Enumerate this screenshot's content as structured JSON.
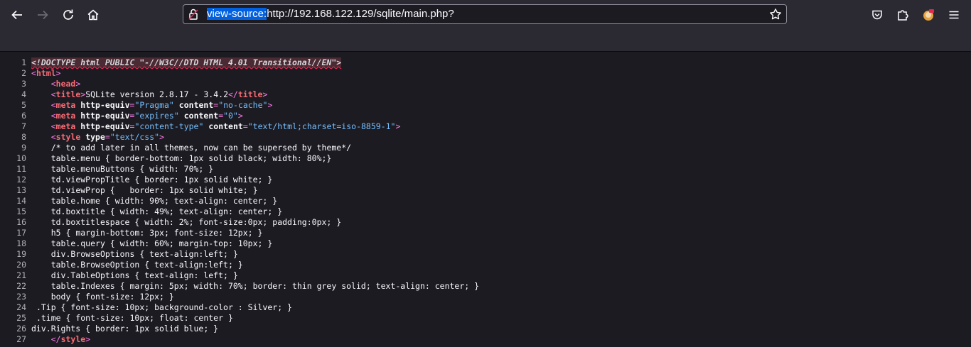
{
  "browser": {
    "url_prefix": "view-source:",
    "url_rest": "http://192.168.122.129/sqlite/main.php?"
  },
  "source": {
    "doctype": "<!DOCTYPE html PUBLIC \"-//W3C//DTD HTML 4.01 Transitional//EN\">",
    "html_open": "html",
    "head_open": "head",
    "title_tag": "title",
    "title_text": "SQLite version 2.8.17 - 3.4.2",
    "meta_tag": "meta",
    "http_equiv": "http-equiv",
    "content": "content",
    "meta1_equiv": "\"Pragma\"",
    "meta1_content": "\"no-cache\"",
    "meta2_equiv": "\"expires\"",
    "meta2_content": "\"0\"",
    "meta3_equiv": "\"content-type\"",
    "meta3_content": "\"text/html;charset=iso-8859-1\"",
    "style_tag": "style",
    "type_attr": "type",
    "style_type": "\"text/css\"",
    "css_lines": [
      "/* to add later in all themes, now can be supersed by theme*/",
      "table.menu { border-bottom: 1px solid black; width: 80%;}",
      "table.menuButtons { width: 70%; }",
      "td.viewPropTitle { border: 1px solid white; }",
      "td.viewProp {   border: 1px solid white; }",
      "table.home { width: 90%; text-align: center; }",
      "td.boxtitle { width: 49%; text-align: center; }",
      "td.boxtitlespace { width: 2%; font-size:0px; padding:0px; }",
      "h5 { margin-bottom: 3px; font-size: 12px; }",
      "table.query { width: 60%; margin-top: 10px; }",
      "div.BrowseOptions { text-align:left; }",
      "table.BrowseOption { text-align:left; }",
      "div.TableOptions { text-align: left; }",
      "table.Indexes { margin: 5px; width: 70%; border: thin grey solid; text-align: center; }",
      "body { font-size: 12px; }",
      ".Tip { font-size: 10px; background-color : Silver; }",
      ".time { font-size: 10px; float: center }",
      "div.Rights { border: 1px solid blue; }"
    ],
    "line_numbers": [
      "1",
      "2",
      "3",
      "4",
      "5",
      "6",
      "7",
      "8",
      "9",
      "10",
      "11",
      "12",
      "13",
      "14",
      "15",
      "16",
      "17",
      "18",
      "19",
      "20",
      "21",
      "22",
      "23",
      "24",
      "25",
      "26",
      "27"
    ]
  }
}
